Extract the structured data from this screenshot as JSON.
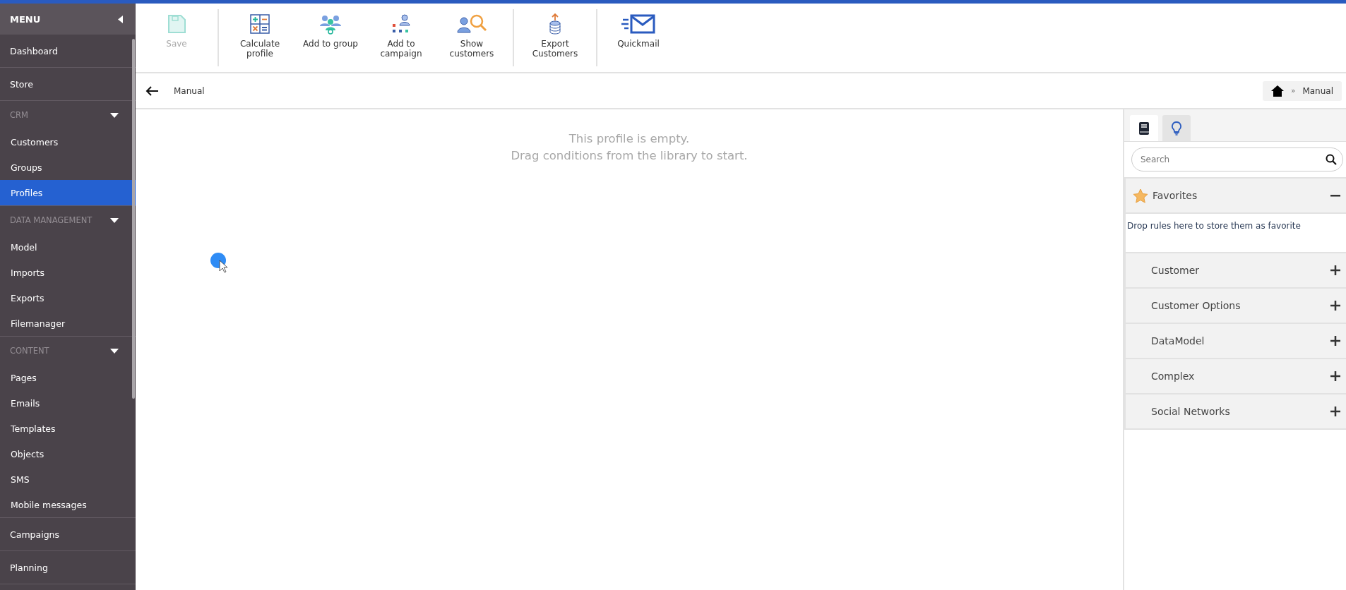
{
  "sidebar": {
    "title": "MENU",
    "items": [
      {
        "kind": "link",
        "label": "Dashboard",
        "selected": false
      },
      {
        "kind": "link",
        "label": "Store",
        "selected": false
      },
      {
        "kind": "section",
        "label": "CRM",
        "expanded": true,
        "children": [
          {
            "label": "Customers",
            "selected": false
          },
          {
            "label": "Groups",
            "selected": false
          },
          {
            "label": "Profiles",
            "selected": true
          }
        ]
      },
      {
        "kind": "section",
        "label": "DATA MANAGEMENT",
        "expanded": true,
        "children": [
          {
            "label": "Model",
            "selected": false
          },
          {
            "label": "Imports",
            "selected": false
          },
          {
            "label": "Exports",
            "selected": false
          },
          {
            "label": "Filemanager",
            "selected": false
          }
        ]
      },
      {
        "kind": "section",
        "label": "CONTENT",
        "expanded": true,
        "children": [
          {
            "label": "Pages",
            "selected": false
          },
          {
            "label": "Emails",
            "selected": false
          },
          {
            "label": "Templates",
            "selected": false
          },
          {
            "label": "Objects",
            "selected": false
          },
          {
            "label": "SMS",
            "selected": false
          },
          {
            "label": "Mobile messages",
            "selected": false
          }
        ]
      },
      {
        "kind": "link",
        "label": "Campaigns",
        "selected": false
      },
      {
        "kind": "link",
        "label": "Planning",
        "selected": false
      }
    ]
  },
  "toolbar": {
    "groups": [
      [
        {
          "kind": "save",
          "label": "Save",
          "disabled": true
        }
      ],
      [
        {
          "kind": "calculate",
          "label": "Calculate\nprofile",
          "disabled": false
        },
        {
          "kind": "group",
          "label": "Add to group",
          "disabled": false
        },
        {
          "kind": "campaign",
          "label": "Add to\ncampaign",
          "disabled": false
        },
        {
          "kind": "search-people",
          "label": "Show\ncustomers",
          "disabled": false
        }
      ],
      [
        {
          "kind": "export",
          "label": "Export\nCustomers",
          "disabled": false
        }
      ],
      [
        {
          "kind": "mail",
          "label": "Quickmail",
          "disabled": false
        }
      ]
    ]
  },
  "header": {
    "title": "Manual",
    "breadcrumb": [
      "»",
      "Manual"
    ]
  },
  "canvas": {
    "empty_message": [
      "This profile is empty.",
      "Drag conditions from the library to start."
    ]
  },
  "library": {
    "tabs": [
      {
        "kind": "book",
        "selected": true
      },
      {
        "kind": "bulb",
        "selected": false
      }
    ],
    "search": {
      "placeholder": "Search"
    },
    "categories": [
      {
        "label": "Favorites",
        "kind": "favorites",
        "expanded": true,
        "hint": "Drop rules here to store them as favorite"
      },
      {
        "label": "Customer",
        "kind": "plain",
        "expanded": false
      },
      {
        "label": "Customer Options",
        "kind": "plain",
        "expanded": false
      },
      {
        "label": "DataModel",
        "kind": "plain",
        "expanded": false
      },
      {
        "label": "Complex",
        "kind": "plain",
        "expanded": false
      },
      {
        "label": "Social Networks",
        "kind": "plain",
        "expanded": false
      }
    ]
  }
}
